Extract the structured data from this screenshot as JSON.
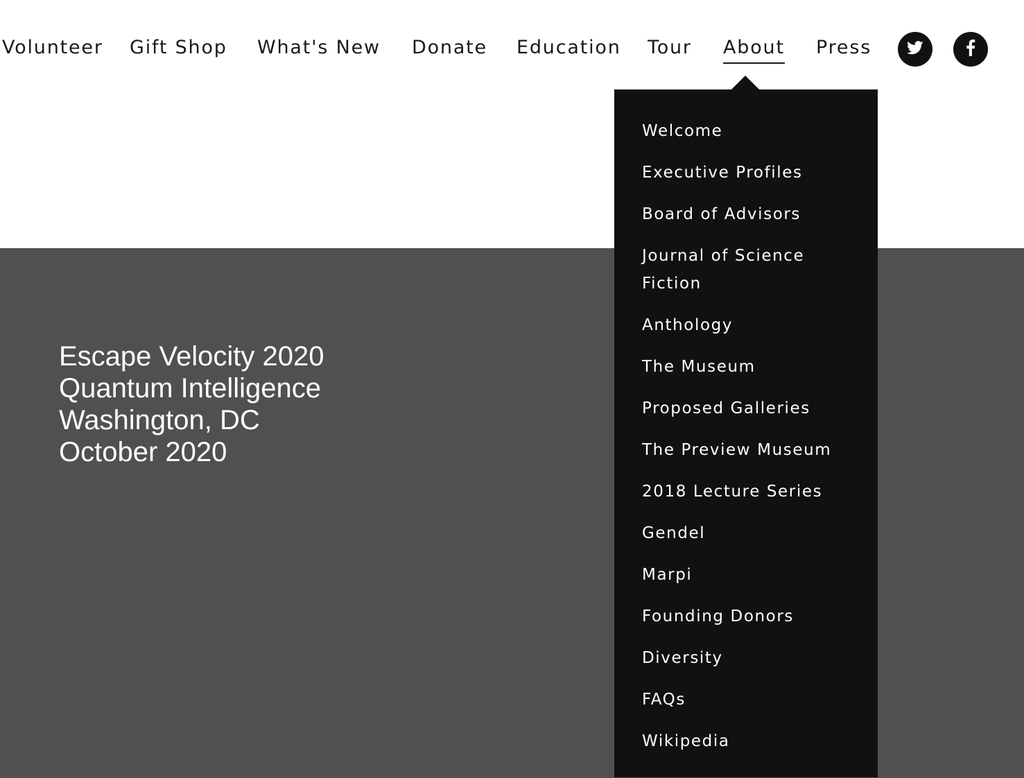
{
  "nav": {
    "items": [
      {
        "label": "Volunteer"
      },
      {
        "label": "Gift Shop"
      },
      {
        "label": "What's New"
      },
      {
        "label": "Donate"
      },
      {
        "label": "Education"
      },
      {
        "label": "Tour"
      },
      {
        "label": "About",
        "active": true
      },
      {
        "label": "Press"
      }
    ],
    "social": [
      {
        "icon": "twitter-icon"
      },
      {
        "icon": "facebook-icon"
      }
    ]
  },
  "hero": {
    "lines": [
      "Escape Velocity 2020",
      "Quantum Intelligence",
      "Washington, DC",
      "October 2020"
    ]
  },
  "about_menu": {
    "items": [
      "Welcome",
      "Executive Profiles",
      "Board of Advisors",
      "Journal of Science Fiction",
      "Anthology",
      "The Museum",
      "Proposed Galleries",
      "The Preview Museum",
      "2018 Lecture Series",
      "Gendel",
      "Marpi",
      "Founding Donors",
      "Diversity",
      "FAQs",
      "Wikipedia"
    ]
  },
  "colors": {
    "hero_bg": "#505050",
    "dropdown_bg": "#111111",
    "nav_text": "#1a1a1a"
  }
}
